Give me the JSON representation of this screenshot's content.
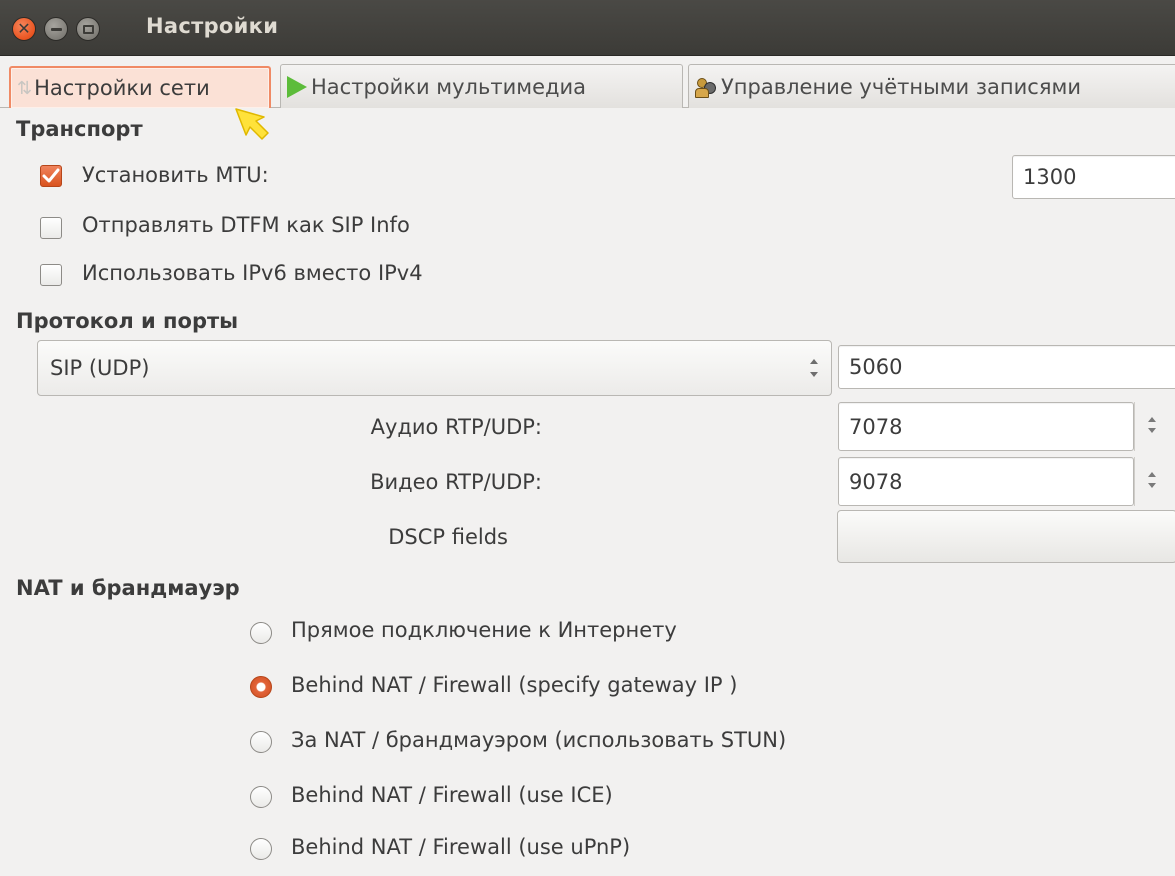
{
  "window": {
    "title": "Настройки"
  },
  "tabs": [
    {
      "label": "Настройки сети",
      "icon": "arrows-icon",
      "active": true
    },
    {
      "label": "Настройки мультимедиа",
      "icon": "play-icon",
      "active": false
    },
    {
      "label": "Управление учётными записями",
      "icon": "accounts-icon",
      "active": false
    }
  ],
  "transport": {
    "heading": "Транспорт",
    "set_mtu": {
      "label": "Установить MTU:",
      "checked": true,
      "value": "1300"
    },
    "dtmf_sip_info": {
      "label": "Отправлять DTFM как SIP Info",
      "checked": false
    },
    "use_ipv6": {
      "label": "Использовать IPv6 вместо IPv4",
      "checked": false
    }
  },
  "protocol": {
    "heading": "Протокол и порты",
    "selected": "SIP (UDP)",
    "sip_port": "5060",
    "audio_label": "Аудио RTP/UDP:",
    "audio_port": "7078",
    "video_label": "Видео RTP/UDP:",
    "video_port": "9078",
    "dscp_label": "DSCP fields"
  },
  "nat": {
    "heading": "NAT и брандмауэр",
    "options": [
      {
        "label": "Прямое подключение к Интернету",
        "checked": false
      },
      {
        "label": "Behind NAT / Firewall (specify gateway IP )",
        "checked": true
      },
      {
        "label": "За NAT / брандмауэром (использовать STUN)",
        "checked": false
      },
      {
        "label": "Behind NAT / Firewall (use ICE)",
        "checked": false
      },
      {
        "label": "Behind NAT / Firewall (use uPnP)",
        "checked": false
      }
    ]
  },
  "colors": {
    "accent": "#e95420",
    "titlebar": "#3c3b37",
    "background": "#f2f1f0"
  }
}
